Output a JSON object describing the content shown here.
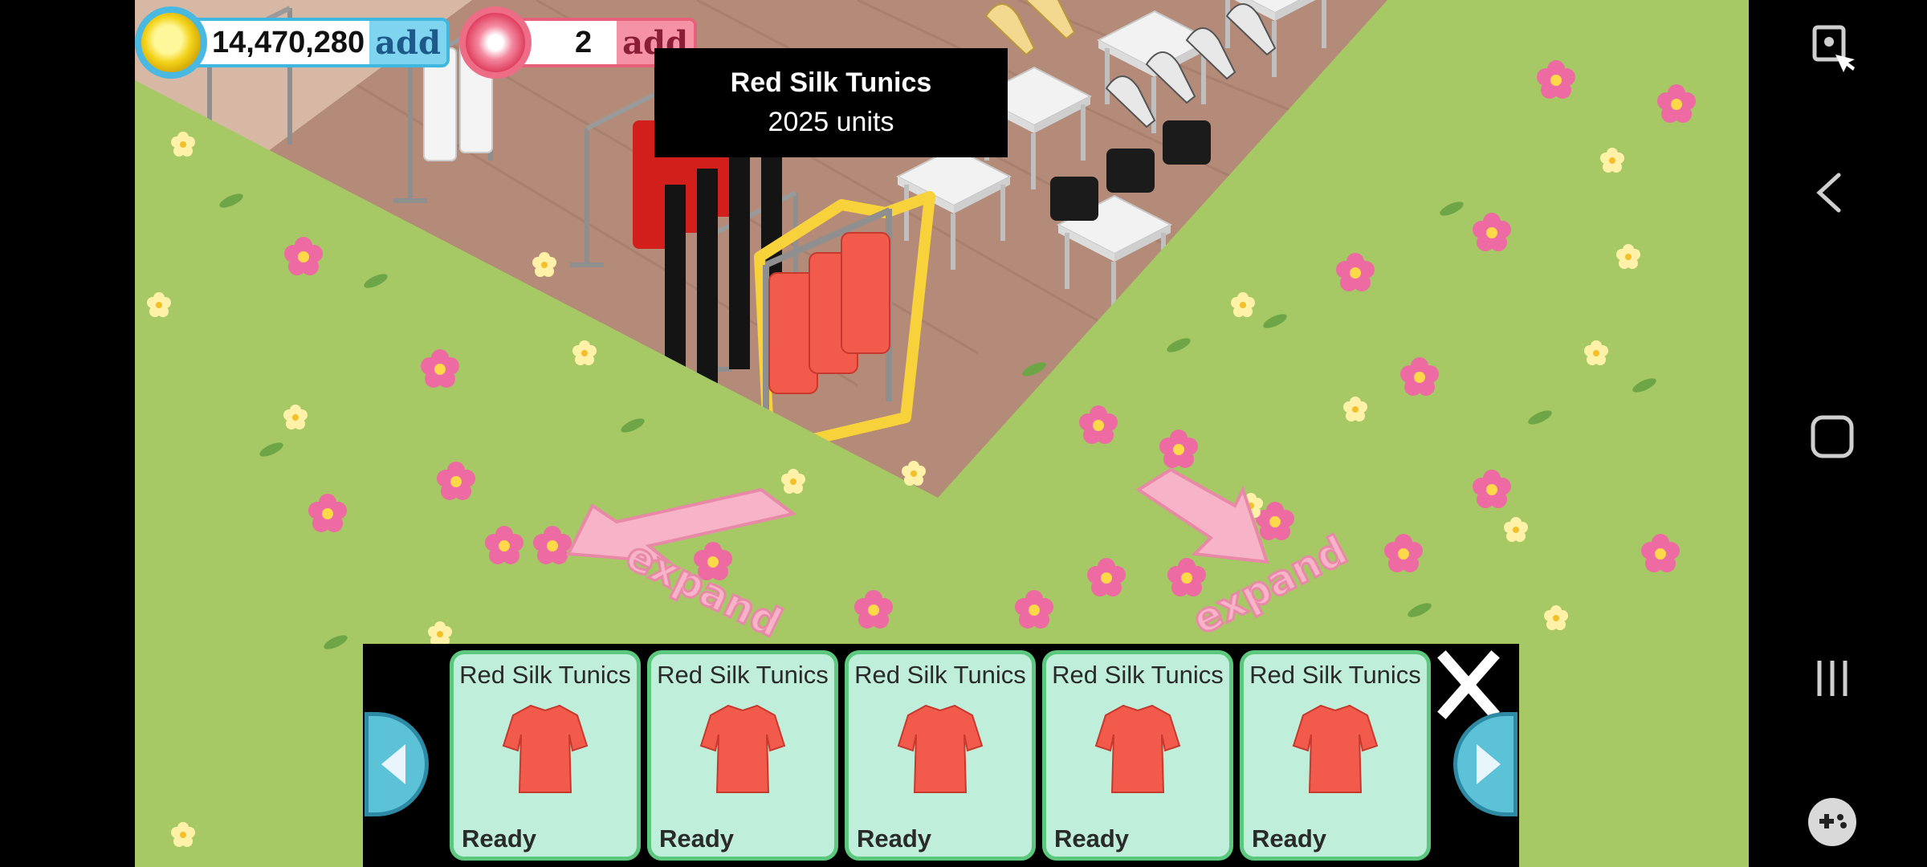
{
  "hud": {
    "coins": "14,470,280",
    "coin_add": "add",
    "gems": "2",
    "gem_add": "add"
  },
  "tooltip": {
    "title": "Red Silk Tunics",
    "subtitle": "2025 units"
  },
  "expand_labels": [
    "expand",
    "expand"
  ],
  "inventory": {
    "items": [
      {
        "name": "Red Silk Tunics",
        "status": "Ready"
      },
      {
        "name": "Red Silk Tunics",
        "status": "Ready"
      },
      {
        "name": "Red Silk Tunics",
        "status": "Ready"
      },
      {
        "name": "Red Silk Tunics",
        "status": "Ready"
      },
      {
        "name": "Red Silk Tunics",
        "status": "Ready"
      }
    ]
  },
  "colors": {
    "grass": "#a6c965",
    "floor": "#b48a78",
    "card_bg": "#bfeeda",
    "card_border": "#5cc87d",
    "shirt": "#f25a4c"
  },
  "icons": {
    "close": "close-icon",
    "prev": "arrow-left-icon",
    "next": "arrow-right-icon",
    "sys_screenshot": "screenshot-icon",
    "sys_back": "back-icon",
    "sys_home": "home-icon",
    "sys_recents": "recents-icon",
    "sys_game": "gamepad-icon"
  }
}
